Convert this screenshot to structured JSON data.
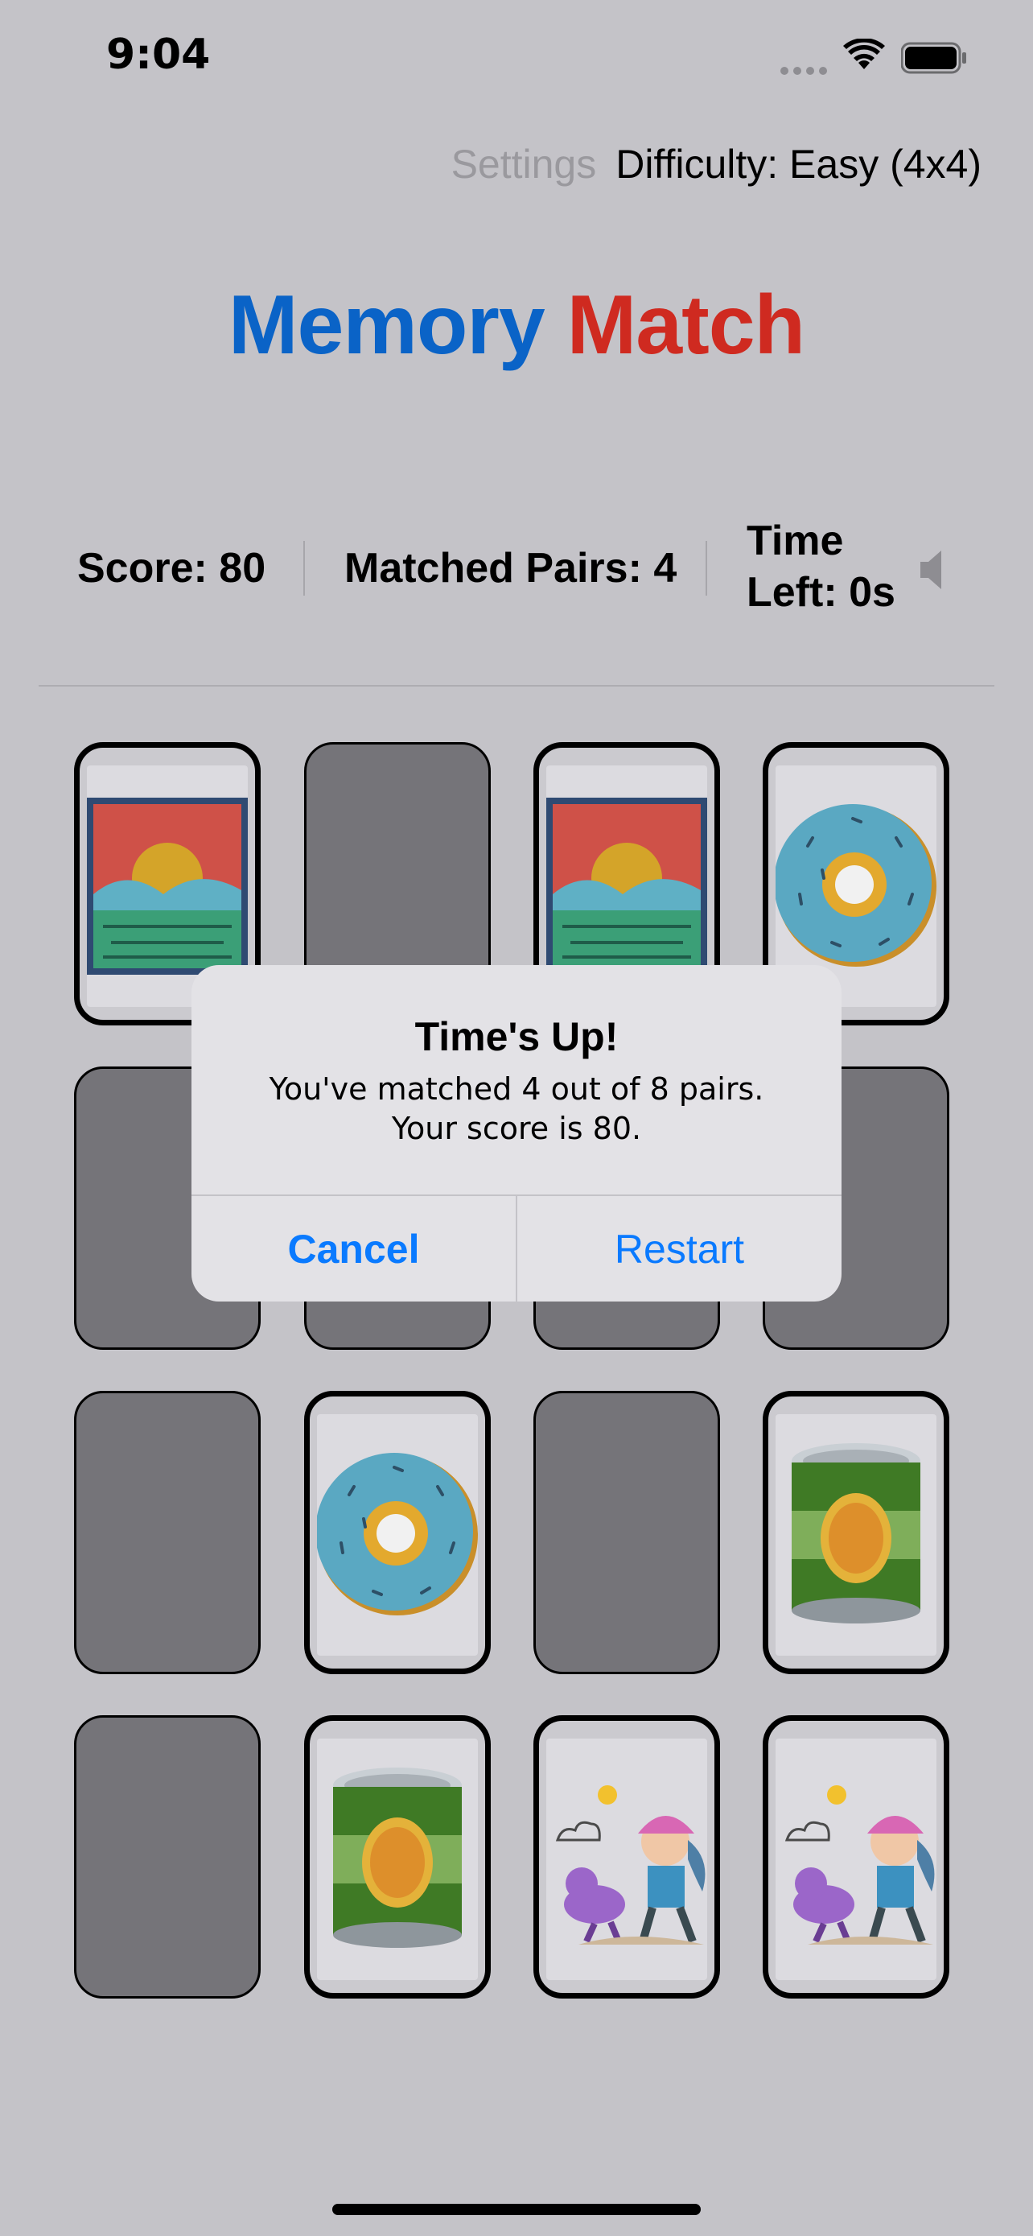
{
  "status_bar": {
    "time": "9:04"
  },
  "top_nav": {
    "settings_label": "Settings",
    "difficulty_label": "Difficulty: Easy (4x4)"
  },
  "title": {
    "part1": "Memory",
    "part2": "Match",
    "color1": "#0a63c7",
    "color2": "#cf2a20"
  },
  "stats": {
    "score": "Score: 80",
    "matched": "Matched Pairs: 4",
    "time_line1": "Time",
    "time_line2": "Left: 0s",
    "sound_icon": "speaker-icon"
  },
  "board": {
    "rows": [
      [
        "sunset",
        "down",
        "sunset",
        "donut"
      ],
      [
        "down",
        "down",
        "down",
        "down"
      ],
      [
        "down",
        "donut",
        "down",
        "can"
      ],
      [
        "down",
        "can",
        "girl-dog",
        "girl-dog"
      ]
    ]
  },
  "alert": {
    "title": "Time's Up!",
    "message": "You've matched 4 out of 8 pairs. Your score is 80.",
    "cancel_label": "Cancel",
    "restart_label": "Restart",
    "accent": "#0a7aff"
  }
}
